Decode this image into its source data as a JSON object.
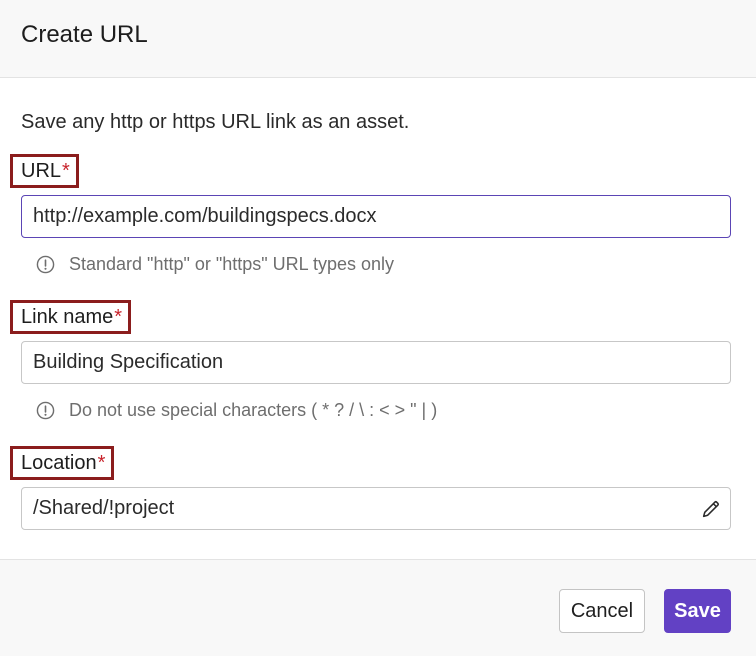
{
  "dialog": {
    "title": "Create URL",
    "description": "Save any http or https URL link as an asset."
  },
  "fields": {
    "url": {
      "label": "URL",
      "required_mark": "*",
      "value": "http://example.com/buildingspecs.docx",
      "hint": "Standard \"http\" or \"https\" URL types only"
    },
    "link_name": {
      "label": "Link name",
      "required_mark": "*",
      "value": "Building Specification",
      "hint": "Do not use special characters ( * ? / \\ : < > \" | )"
    },
    "location": {
      "label": "Location",
      "required_mark": "*",
      "value": "/Shared/!project",
      "icon": "pencil-icon"
    }
  },
  "footer": {
    "cancel_label": "Cancel",
    "save_label": "Save"
  },
  "colors": {
    "accent": "#6241c4",
    "required": "#c8232c",
    "highlight_border": "#8b1d1d"
  }
}
